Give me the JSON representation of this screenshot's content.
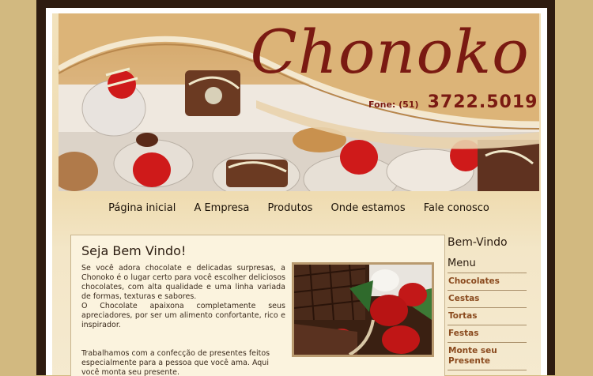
{
  "brand": {
    "name": "Chonoko",
    "phone_label": "Fone: (51)",
    "phone_number": "3722.5019"
  },
  "nav": {
    "items": [
      {
        "label": "Página inicial"
      },
      {
        "label": "A Empresa"
      },
      {
        "label": "Produtos"
      },
      {
        "label": "Onde estamos"
      },
      {
        "label": "Fale conosco"
      }
    ]
  },
  "content": {
    "title": "Seja Bem Vindo!",
    "paragraph1": "Se você adora chocolate e delicadas surpresas, a Chonoko é o lugar certo para você escolher deliciosos chocolates, com alta qualidade e uma linha variada de formas, texturas e sabores.",
    "paragraph2": "O Chocolate apaixona completamente seus apreciadores, por ser um alimento confortante, rico e inspirador.",
    "paragraph3": "Trabalhamos com a confecção de presentes feitos especialmente para a pessoa que você ama. Aqui você monta seu presente."
  },
  "sidebar": {
    "title": "Bem-Vindo",
    "menu_heading": "Menu",
    "items": [
      {
        "label": "Chocolates"
      },
      {
        "label": "Cestas"
      },
      {
        "label": "Tortas"
      },
      {
        "label": "Festas"
      },
      {
        "label": "Monte seu Presente"
      }
    ]
  },
  "colors": {
    "background": "#d2b980",
    "frame": "#2e1c10",
    "brand": "#7a1a12",
    "menu_link": "#8a4a1e"
  }
}
